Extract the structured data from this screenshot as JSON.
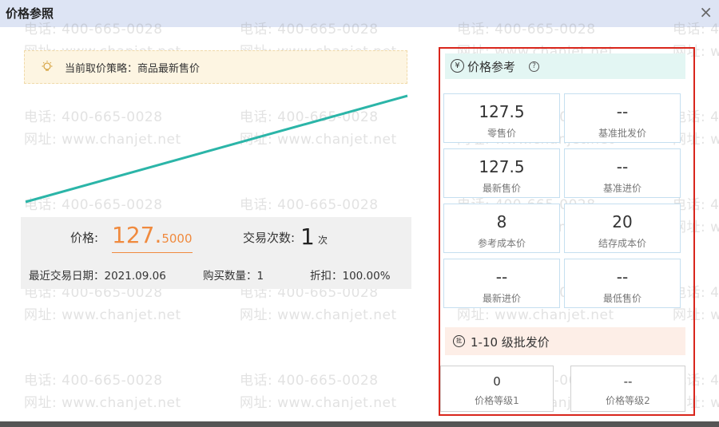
{
  "window": {
    "title": "价格参照",
    "close_glyph": "×"
  },
  "watermark": {
    "line1": "电话: 400-665-0028",
    "line2": "网址: www.chanjet.net"
  },
  "strategy": {
    "text": "当前取价策略：商品最新售价",
    "icon": "lightbulb-icon"
  },
  "chart_data": {
    "type": "line",
    "x": [
      0,
      1
    ],
    "series": [
      {
        "values": [
          0,
          1
        ]
      }
    ],
    "color": "#2bb5a8",
    "grid": false
  },
  "price_summary": {
    "price_label": "价格:",
    "price_value": "127.5000",
    "count_label": "交易次数:",
    "count_value": "1",
    "count_unit": "次",
    "date_text": "最近交易日期：2021.09.06",
    "qty_text": "购买数量：1",
    "discount_text": "折扣：100.00%"
  },
  "reference": {
    "title": "价格参考",
    "icon": "yen-icon",
    "cells": [
      {
        "value": "127.5",
        "label": "零售价"
      },
      {
        "value": "--",
        "label": "基准批发价"
      },
      {
        "value": "127.5",
        "label": "最新售价"
      },
      {
        "value": "--",
        "label": "基准进价"
      },
      {
        "value": "8",
        "label": "参考成本价"
      },
      {
        "value": "20",
        "label": "结存成本价"
      },
      {
        "value": "--",
        "label": "最新进价"
      },
      {
        "value": "--",
        "label": "最低售价"
      }
    ]
  },
  "batch": {
    "title": "1-10 级批发价",
    "icon": "batch-price-icon",
    "cells": [
      {
        "value": "0",
        "label": "价格等级1"
      },
      {
        "value": "--",
        "label": "价格等级2"
      }
    ]
  }
}
